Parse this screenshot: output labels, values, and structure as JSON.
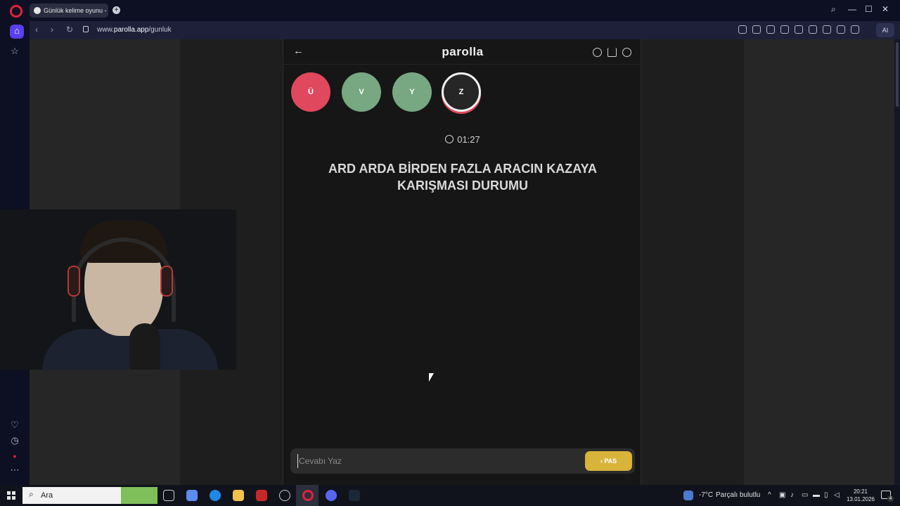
{
  "browser": {
    "tab_title": "Günlük kelime oyunu - pa",
    "new_tab_label": "+",
    "url_prefix": "www.",
    "url_domain": "parolla.app",
    "url_path": "/gunluk",
    "ai_label": "AI"
  },
  "window_controls": {
    "search": "⌕",
    "minimize": "—",
    "maximize": "☐",
    "close": "✕"
  },
  "game": {
    "logo": "parolla",
    "back": "←",
    "letters": [
      {
        "label": "Ü",
        "state": "wrong"
      },
      {
        "label": "V",
        "state": "correct"
      },
      {
        "label": "Y",
        "state": "correct"
      },
      {
        "label": "Z",
        "state": "active"
      }
    ],
    "timer": "01:27",
    "question": "ARD ARDA BİRDEN FAZLA ARACIN KAZAYA KARIŞMASI DURUMU",
    "answer_placeholder": "Cevabı Yaz",
    "pas_label": "PAS",
    "pas_arrow": "›"
  },
  "taskbar": {
    "search_label": "Ara",
    "search_icon": "⌕",
    "weather_temp": "-7°C",
    "weather_text": "Parçalı bulutlu",
    "time": "20:21",
    "date": "13.01.2026",
    "notif_count": "4",
    "tray_chevron": "^"
  },
  "colors": {
    "wrong": "#e0485d",
    "correct": "#77a882",
    "pas": "#d8b43a",
    "accent": "#5b3ef0"
  }
}
